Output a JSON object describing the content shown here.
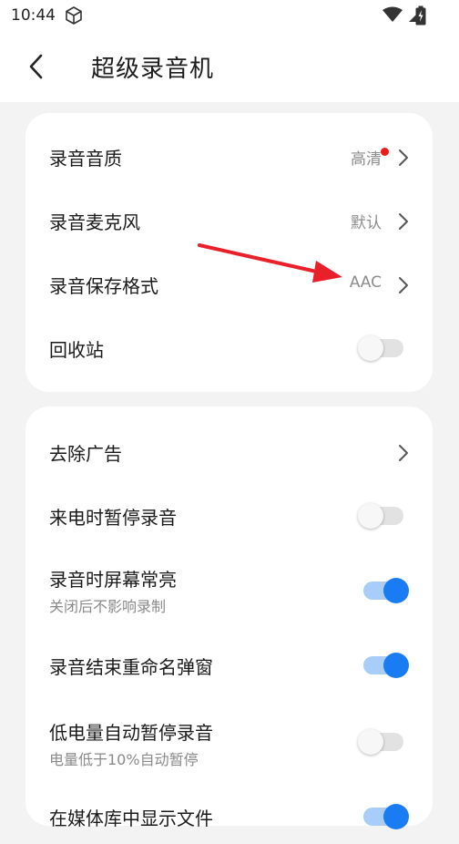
{
  "status_bar": {
    "time": "10:44"
  },
  "header": {
    "title": "超级录音机"
  },
  "card1": {
    "rows": [
      {
        "label": "录音音质",
        "value": "高清"
      },
      {
        "label": "录音麦克风",
        "value": "默认"
      },
      {
        "label": "录音保存格式",
        "value": "AAC"
      },
      {
        "label": "回收站",
        "toggle": false
      }
    ]
  },
  "card2": {
    "rows": [
      {
        "label": "去除广告"
      },
      {
        "label": "来电时暂停录音",
        "toggle": false
      },
      {
        "label": "录音时屏幕常亮",
        "sub": "关闭后不影响录制",
        "toggle": true
      },
      {
        "label": "录音结束重命名弹窗",
        "toggle": true
      },
      {
        "label": "低电量自动暂停录音",
        "sub": "电量低于10%自动暂停",
        "toggle": false
      },
      {
        "label": "在媒体库中显示文件",
        "toggle": true
      }
    ]
  },
  "colors": {
    "accent": "#1a7cf3",
    "annotation": "#e8202a"
  }
}
